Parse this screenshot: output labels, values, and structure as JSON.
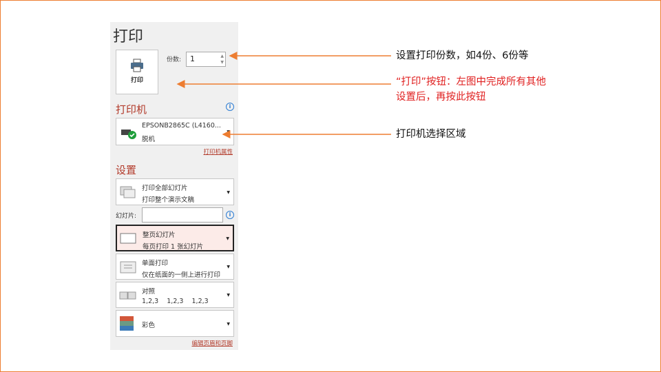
{
  "panel": {
    "title": "打印",
    "print_button": "打印",
    "copies_label": "份数:",
    "copies_value": "1",
    "printer_section": "打印机",
    "printer_name": "EPSONB2865C (L4160...",
    "printer_status": "脱机",
    "printer_properties": "打印机属性",
    "settings_section": "设置",
    "settings": [
      {
        "line1": "打印全部幻灯片",
        "line2": "打印整个演示文稿"
      },
      {
        "line1": "整页幻灯片",
        "line2": "每页打印 1 张幻灯片"
      },
      {
        "line1": "单面打印",
        "line2": "仅在纸面的一侧上进行打印"
      },
      {
        "line1": "对照",
        "line2": "1,2,3    1,2,3    1,2,3"
      },
      {
        "line1": "彩色"
      }
    ],
    "slides_label": "幻灯片:",
    "slides_value": "",
    "edit_header_footer": "编辑页眉和页脚"
  },
  "annotations": {
    "copies": "设置打印份数，如4份、6份等",
    "print_button_l1": "“打印”按钮：左图中完成所有其他",
    "print_button_l2": "设置后，再按此按钮",
    "printer": "打印机选择区域"
  },
  "colors": {
    "accent": "#ed7d31",
    "section": "#b23a2a",
    "note_red": "#e02020"
  }
}
